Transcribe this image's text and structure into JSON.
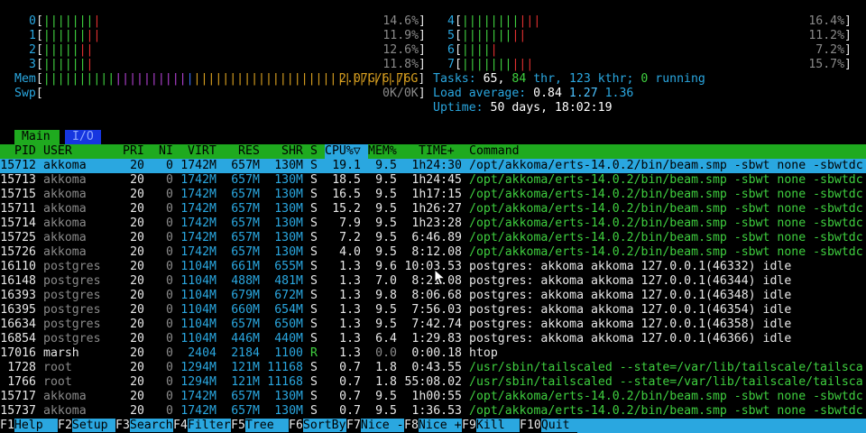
{
  "cpus": [
    {
      "id": "0",
      "green": "|||||||",
      "red": "|",
      "pct": "14.6%"
    },
    {
      "id": "1",
      "green": "||||||",
      "red": "||",
      "pct": "11.9%"
    },
    {
      "id": "2",
      "green": "|||||",
      "red": "||",
      "pct": "12.6%"
    },
    {
      "id": "3",
      "green": "||||||",
      "red": "|",
      "pct": "11.8%"
    },
    {
      "id": "4",
      "green": "||||||||",
      "red": "|||",
      "pct": "16.4%"
    },
    {
      "id": "5",
      "green": "|||||||",
      "red": "||",
      "pct": "11.2%"
    },
    {
      "id": "6",
      "green": "||||",
      "red": "|",
      "pct": "7.2%"
    },
    {
      "id": "7",
      "green": "|||||||",
      "red": "|||",
      "pct": "15.7%"
    }
  ],
  "mem": {
    "label": "Mem",
    "bar_green": "||||||||||",
    "bar_mag": "||||||||||",
    "bar_blue": "|",
    "bar_yellow": "||||||||||||||||||||||||||||||",
    "value": "2.07G/6.76G"
  },
  "swp": {
    "label": "Swp",
    "value": "0K/0K"
  },
  "tasks": {
    "label": "Tasks:",
    "count": "65,",
    "thr": "84",
    "thr_label": "thr,",
    "kthr": "123 kthr;",
    "running": "0",
    "running_label": "running"
  },
  "load": {
    "label": "Load average:",
    "v1": "0.84",
    "v2": "1.27",
    "v3": "1.36"
  },
  "uptime": {
    "label": "Uptime:",
    "value": "50 days, 18:02:19"
  },
  "tabs": {
    "main": "Main",
    "io": "I/O"
  },
  "columns": {
    "pid": "PID",
    "user": "USER",
    "pri": "PRI",
    "ni": "NI",
    "virt": "VIRT",
    "res": "RES",
    "shr": "SHR",
    "s": "S",
    "cpu": "CPU%",
    "sort_arrow": "▽",
    "mem": "MEM%",
    "time": "TIME+",
    "command": "Command"
  },
  "processes": [
    {
      "pid": "15712",
      "user": "akkoma",
      "pri": "20",
      "ni": "0",
      "virt": "1742M",
      "res": "657M",
      "shr": "130M",
      "s": "S",
      "cpu": "19.1",
      "mem": "9.5",
      "time": "1h24:30",
      "cmd": "/opt/akkoma/erts-14.0.2/bin/beam.smp -sbwt none -sbwtdc"
    },
    {
      "pid": "15713",
      "user": "akkoma",
      "pri": "20",
      "ni": "0",
      "virt": "1742M",
      "res": "657M",
      "shr": "130M",
      "s": "S",
      "cpu": "18.5",
      "mem": "9.5",
      "time": "1h24:45",
      "cmd": "/opt/akkoma/erts-14.0.2/bin/beam.smp -sbwt none -sbwtdc"
    },
    {
      "pid": "15715",
      "user": "akkoma",
      "pri": "20",
      "ni": "0",
      "virt": "1742M",
      "res": "657M",
      "shr": "130M",
      "s": "S",
      "cpu": "16.5",
      "mem": "9.5",
      "time": "1h17:15",
      "cmd": "/opt/akkoma/erts-14.0.2/bin/beam.smp -sbwt none -sbwtdc"
    },
    {
      "pid": "15711",
      "user": "akkoma",
      "pri": "20",
      "ni": "0",
      "virt": "1742M",
      "res": "657M",
      "shr": "130M",
      "s": "S",
      "cpu": "15.2",
      "mem": "9.5",
      "time": "1h26:27",
      "cmd": "/opt/akkoma/erts-14.0.2/bin/beam.smp -sbwt none -sbwtdc"
    },
    {
      "pid": "15714",
      "user": "akkoma",
      "pri": "20",
      "ni": "0",
      "virt": "1742M",
      "res": "657M",
      "shr": "130M",
      "s": "S",
      "cpu": "7.9",
      "mem": "9.5",
      "time": "1h23:28",
      "cmd": "/opt/akkoma/erts-14.0.2/bin/beam.smp -sbwt none -sbwtdc"
    },
    {
      "pid": "15725",
      "user": "akkoma",
      "pri": "20",
      "ni": "0",
      "virt": "1742M",
      "res": "657M",
      "shr": "130M",
      "s": "S",
      "cpu": "7.2",
      "mem": "9.5",
      "time": "6:46.89",
      "cmd": "/opt/akkoma/erts-14.0.2/bin/beam.smp -sbwt none -sbwtdc"
    },
    {
      "pid": "15726",
      "user": "akkoma",
      "pri": "20",
      "ni": "0",
      "virt": "1742M",
      "res": "657M",
      "shr": "130M",
      "s": "S",
      "cpu": "4.0",
      "mem": "9.5",
      "time": "8:12.08",
      "cmd": "/opt/akkoma/erts-14.0.2/bin/beam.smp -sbwt none -sbwtdc"
    },
    {
      "pid": "16110",
      "user": "postgres",
      "pri": "20",
      "ni": "0",
      "virt": "1104M",
      "res": "661M",
      "shr": "655M",
      "s": "S",
      "cpu": "1.3",
      "mem": "9.6",
      "time": "10:03.53",
      "cmd": "postgres: akkoma akkoma 127.0.0.1(46332) idle"
    },
    {
      "pid": "16148",
      "user": "postgres",
      "pri": "20",
      "ni": "0",
      "virt": "1104M",
      "res": "488M",
      "shr": "481M",
      "s": "S",
      "cpu": "1.3",
      "mem": "7.0",
      "time": "8:21.08",
      "cmd": "postgres: akkoma akkoma 127.0.0.1(46344) idle"
    },
    {
      "pid": "16393",
      "user": "postgres",
      "pri": "20",
      "ni": "0",
      "virt": "1104M",
      "res": "679M",
      "shr": "672M",
      "s": "S",
      "cpu": "1.3",
      "mem": "9.8",
      "time": "8:06.68",
      "cmd": "postgres: akkoma akkoma 127.0.0.1(46348) idle"
    },
    {
      "pid": "16395",
      "user": "postgres",
      "pri": "20",
      "ni": "0",
      "virt": "1104M",
      "res": "660M",
      "shr": "654M",
      "s": "S",
      "cpu": "1.3",
      "mem": "9.5",
      "time": "7:56.03",
      "cmd": "postgres: akkoma akkoma 127.0.0.1(46354) idle"
    },
    {
      "pid": "16634",
      "user": "postgres",
      "pri": "20",
      "ni": "0",
      "virt": "1104M",
      "res": "657M",
      "shr": "650M",
      "s": "S",
      "cpu": "1.3",
      "mem": "9.5",
      "time": "7:42.74",
      "cmd": "postgres: akkoma akkoma 127.0.0.1(46358) idle"
    },
    {
      "pid": "16854",
      "user": "postgres",
      "pri": "20",
      "ni": "0",
      "virt": "1104M",
      "res": "446M",
      "shr": "440M",
      "s": "S",
      "cpu": "1.3",
      "mem": "6.4",
      "time": "1:29.83",
      "cmd": "postgres: akkoma akkoma 127.0.0.1(46366) idle"
    },
    {
      "pid": "17016",
      "user": "marsh",
      "pri": "20",
      "ni": "0",
      "virt": "2404",
      "res": "2184",
      "shr": "1100",
      "s": "R",
      "cpu": "1.3",
      "mem": "0.0",
      "time": "0:00.18",
      "cmd": "htop"
    },
    {
      "pid": "1728",
      "user": "root",
      "pri": "20",
      "ni": "0",
      "virt": "1294M",
      "res": "121M",
      "shr": "11168",
      "s": "S",
      "cpu": "0.7",
      "mem": "1.8",
      "time": "0:43.55",
      "cmd": "/usr/sbin/tailscaled --state=/var/lib/tailscale/tailsca"
    },
    {
      "pid": "1766",
      "user": "root",
      "pri": "20",
      "ni": "0",
      "virt": "1294M",
      "res": "121M",
      "shr": "11168",
      "s": "S",
      "cpu": "0.7",
      "mem": "1.8",
      "time": "55:08.02",
      "cmd": "/usr/sbin/tailscaled --state=/var/lib/tailscale/tailsca"
    },
    {
      "pid": "15717",
      "user": "akkoma",
      "pri": "20",
      "ni": "0",
      "virt": "1742M",
      "res": "657M",
      "shr": "130M",
      "s": "S",
      "cpu": "0.7",
      "mem": "9.5",
      "time": "1h00:55",
      "cmd": "/opt/akkoma/erts-14.0.2/bin/beam.smp -sbwt none -sbwtdc"
    },
    {
      "pid": "15737",
      "user": "akkoma",
      "pri": "20",
      "ni": "0",
      "virt": "1742M",
      "res": "657M",
      "shr": "130M",
      "s": "S",
      "cpu": "0.7",
      "mem": "9.5",
      "time": "1:36.53",
      "cmd": "/opt/akkoma/erts-14.0.2/bin/beam.smp -sbwt none -sbwtdc"
    }
  ],
  "footer": [
    {
      "key": "F1",
      "label": "Help  "
    },
    {
      "key": "F2",
      "label": "Setup "
    },
    {
      "key": "F3",
      "label": "Search"
    },
    {
      "key": "F4",
      "label": "Filter"
    },
    {
      "key": "F5",
      "label": "Tree  "
    },
    {
      "key": "F6",
      "label": "SortBy"
    },
    {
      "key": "F7",
      "label": "Nice -"
    },
    {
      "key": "F8",
      "label": "Nice +"
    },
    {
      "key": "F9",
      "label": "Kill  "
    },
    {
      "key": "F10",
      "label": "Quit  "
    }
  ],
  "colors": {
    "accent_green": "#1faa1f",
    "accent_cyan": "#2aa7e0",
    "tab_io_blue": "#1636e0"
  }
}
